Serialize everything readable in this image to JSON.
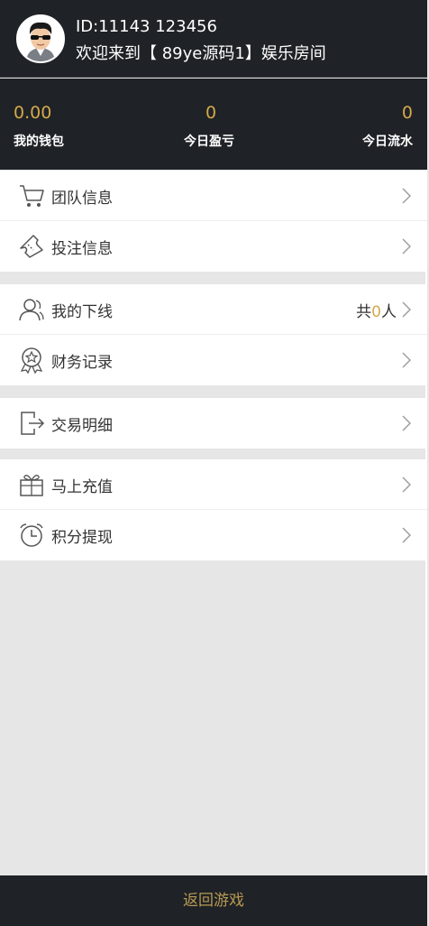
{
  "user": {
    "id_text": "ID:11143 123456",
    "welcome_text": "欢迎来到【 89ye源码1】娱乐房间"
  },
  "stats": [
    {
      "value": "0.00",
      "label": "我的钱包"
    },
    {
      "value": "0",
      "label": "今日盈亏"
    },
    {
      "value": "0",
      "label": "今日流水"
    }
  ],
  "menu": {
    "group1": [
      {
        "label": "团队信息",
        "icon": "cart-icon"
      },
      {
        "label": "投注信息",
        "icon": "ticket-icon"
      }
    ],
    "group2": [
      {
        "label": "我的下线",
        "icon": "users-icon",
        "extra_prefix": "共",
        "extra_count": "0",
        "extra_suffix": "人"
      },
      {
        "label": "财务记录",
        "icon": "award-icon"
      }
    ],
    "group3": [
      {
        "label": "交易明细",
        "icon": "exit-icon"
      }
    ],
    "group4": [
      {
        "label": "马上充值",
        "icon": "gift-icon"
      },
      {
        "label": "积分提现",
        "icon": "alarm-clock-icon"
      }
    ]
  },
  "footer": {
    "return_label": "返回游戏"
  },
  "colors": {
    "header_bg": "#1f2226",
    "accent_gold": "#d4a94a",
    "page_bg": "#e6e6e6"
  }
}
